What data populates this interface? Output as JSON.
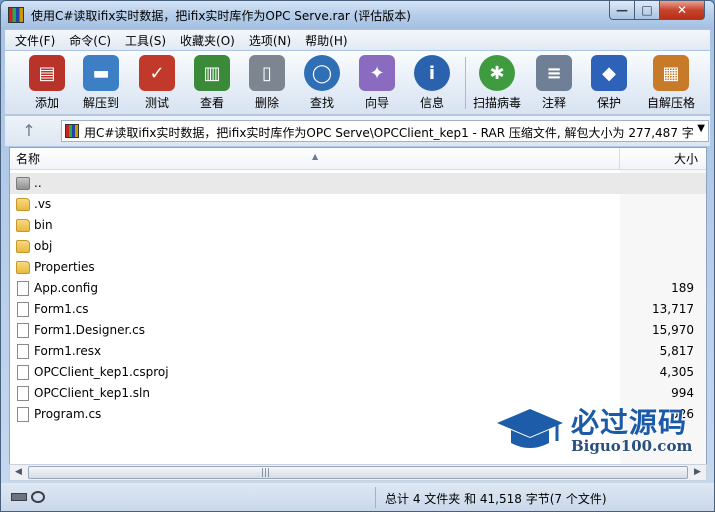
{
  "window": {
    "title": "使用C#读取ifix实时数据，把ifix实时库作为OPC Serve.rar (评估版本)",
    "controls": {
      "minimize": "—",
      "maximize": "□",
      "close": "✕"
    }
  },
  "menu": {
    "items": [
      "文件(F)",
      "命令(C)",
      "工具(S)",
      "收藏夹(O)",
      "选项(N)",
      "帮助(H)"
    ]
  },
  "toolbar": {
    "buttons": [
      {
        "label": "添加",
        "icon": "add-archive-icon",
        "color": "#b8332a",
        "glyph": "▤"
      },
      {
        "label": "解压到",
        "icon": "extract-to-icon",
        "color": "#3d7fc4",
        "glyph": "▬"
      },
      {
        "label": "测试",
        "icon": "test-icon",
        "color": "#c0392b",
        "glyph": "✓"
      },
      {
        "label": "查看",
        "icon": "view-icon",
        "color": "#3a8a3a",
        "glyph": "▥"
      },
      {
        "label": "删除",
        "icon": "delete-icon",
        "color": "#7d8590",
        "glyph": "▯"
      },
      {
        "label": "查找",
        "icon": "find-icon",
        "color": "#2f6fb5",
        "glyph": "◯"
      },
      {
        "label": "向导",
        "icon": "wizard-icon",
        "color": "#8a6bbf",
        "glyph": "✦"
      },
      {
        "label": "信息",
        "icon": "info-icon",
        "color": "#2b62ad",
        "glyph": "i"
      },
      {
        "label": "扫描病毒",
        "icon": "virus-scan-icon",
        "color": "#3f9b3f",
        "glyph": "✱"
      },
      {
        "label": "注释",
        "icon": "comment-icon",
        "color": "#6e7f96",
        "glyph": "≡"
      },
      {
        "label": "保护",
        "icon": "protect-icon",
        "color": "#2d62b8",
        "glyph": "◆"
      },
      {
        "label": "自解压格",
        "icon": "sfx-icon",
        "color": "#c77a28",
        "glyph": "▦"
      }
    ]
  },
  "address": {
    "up_glyph": "↑",
    "path": "用C#读取ifix实时数据，把ifix实时库作为OPC Serve\\OPCClient_kep1 - RAR 压缩文件, 解包大小为 277,487 字节",
    "dropdown_glyph": "▼"
  },
  "list": {
    "columns": {
      "name": "名称",
      "size": "大小",
      "sort_glyph": "▲"
    },
    "rows": [
      {
        "name": "..",
        "size": "",
        "type": "parent"
      },
      {
        "name": ".vs",
        "size": "",
        "type": "folder"
      },
      {
        "name": "bin",
        "size": "",
        "type": "folder"
      },
      {
        "name": "obj",
        "size": "",
        "type": "folder"
      },
      {
        "name": "Properties",
        "size": "",
        "type": "folder"
      },
      {
        "name": "App.config",
        "size": "189",
        "type": "file"
      },
      {
        "name": "Form1.cs",
        "size": "13,717",
        "type": "file"
      },
      {
        "name": "Form1.Designer.cs",
        "size": "15,970",
        "type": "file"
      },
      {
        "name": "Form1.resx",
        "size": "5,817",
        "type": "file"
      },
      {
        "name": "OPCClient_kep1.csproj",
        "size": "4,305",
        "type": "file"
      },
      {
        "name": "OPCClient_kep1.sln",
        "size": "994",
        "type": "file"
      },
      {
        "name": "Program.cs",
        "size": "526",
        "type": "file"
      }
    ]
  },
  "scrollbar": {
    "left": "◀",
    "right": "▶",
    "grip": "|||"
  },
  "status": {
    "text": "总计 4 文件夹 和 41,518 字节(7 个文件)"
  },
  "watermark": {
    "line1": "必过源码",
    "line2": "Biguo100.com"
  }
}
